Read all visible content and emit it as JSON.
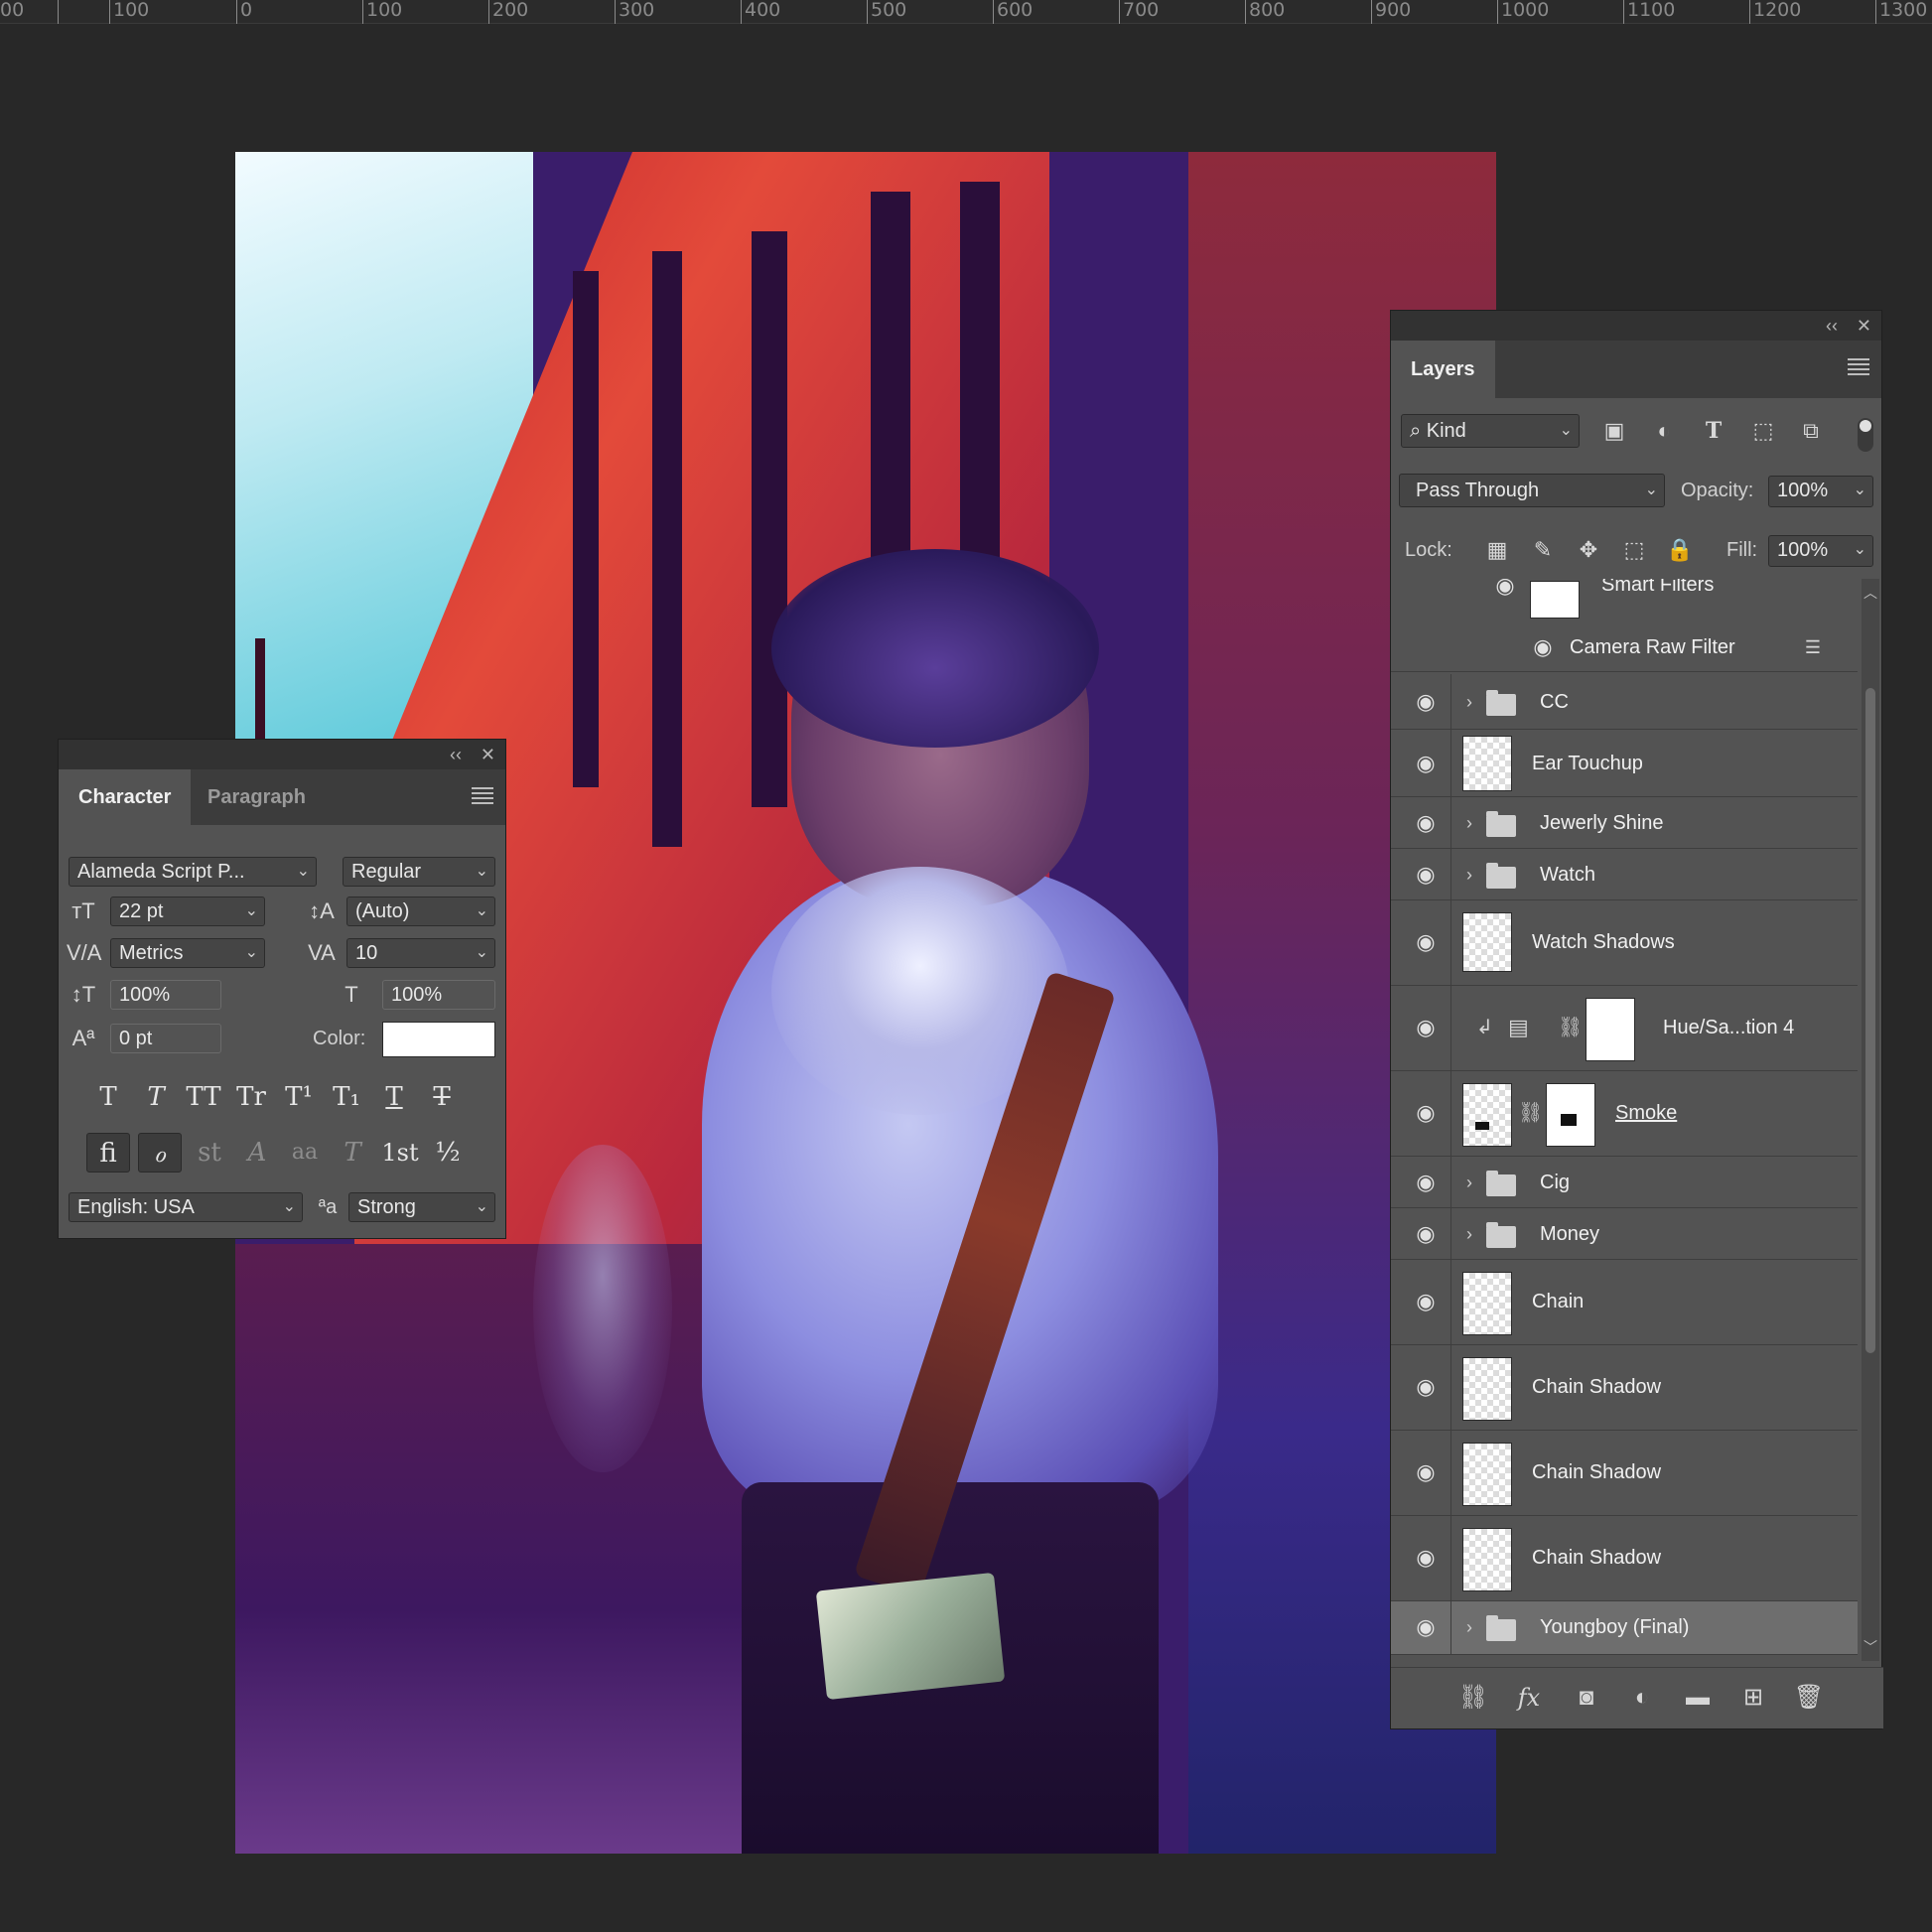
{
  "ruler": {
    "labels": [
      "00",
      "100",
      "0",
      "100",
      "200",
      "300",
      "400",
      "500",
      "600",
      "700",
      "800",
      "900",
      "1000",
      "1100",
      "1200",
      "1300"
    ]
  },
  "character_panel": {
    "tabs": [
      "Character",
      "Paragraph"
    ],
    "font_family": "Alameda Script P...",
    "font_style": "Regular",
    "font_size": "22 pt",
    "leading": "(Auto)",
    "kerning": "Metrics",
    "tracking": "10",
    "vertical_scale": "100%",
    "horizontal_scale": "100%",
    "baseline_shift": "0 pt",
    "color_label": "Color:",
    "color_value": "#ffffff",
    "type_styles": [
      "T",
      "T",
      "TT",
      "Tr",
      "T¹",
      "T₁",
      "T",
      "T"
    ],
    "opentype_features": [
      "fi",
      "ℴ",
      "st",
      "A",
      "aa",
      "T",
      "1st",
      "½"
    ],
    "language": "English: USA",
    "antialias_icon": "ªa",
    "antialias": "Strong"
  },
  "layers_panel": {
    "tab": "Layers",
    "filter_kind": "Kind",
    "blend_mode": "Pass Through",
    "opacity_label": "Opacity:",
    "opacity": "100%",
    "lock_label": "Lock:",
    "fill_label": "Fill:",
    "fill": "100%",
    "smart_filters": "Smart Filters",
    "camera_raw": "Camera Raw Filter",
    "layers": [
      {
        "name": "CC",
        "type": "group"
      },
      {
        "name": "Ear Touchup",
        "type": "pixel"
      },
      {
        "name": "Jewerly Shine",
        "type": "group"
      },
      {
        "name": "Watch",
        "type": "group"
      },
      {
        "name": "Watch Shadows",
        "type": "pixel"
      },
      {
        "name": "Hue/Sa...tion 4",
        "type": "adjustment"
      },
      {
        "name": "Smoke",
        "type": "masked"
      },
      {
        "name": "Cig",
        "type": "group"
      },
      {
        "name": "Money",
        "type": "group"
      },
      {
        "name": "Chain",
        "type": "pixel"
      },
      {
        "name": "Chain Shadow",
        "type": "pixel"
      },
      {
        "name": "Chain Shadow",
        "type": "pixel"
      },
      {
        "name": "Chain Shadow",
        "type": "pixel"
      },
      {
        "name": "Youngboy (Final)",
        "type": "group",
        "selected": true
      }
    ],
    "bottom_icons": [
      "link-icon",
      "fx-icon",
      "mask-icon",
      "adjustment-icon",
      "folder-icon",
      "new-layer-icon",
      "trash-icon"
    ]
  },
  "colors": {
    "app_bg": "#282828",
    "panel_bg": "#535353",
    "panel_header": "#323232",
    "accent_white": "#ffffff"
  }
}
